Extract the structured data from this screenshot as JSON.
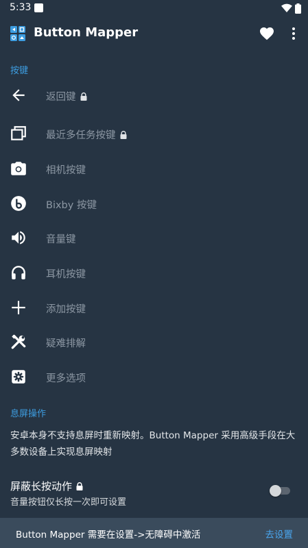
{
  "status_bar": {
    "time": "5:33"
  },
  "app_bar": {
    "title": "Button Mapper"
  },
  "sections": {
    "buttons_header": "按键",
    "screen_off_header": "息屏操作"
  },
  "items": [
    {
      "label": "返回键",
      "icon": "arrow-left-icon",
      "locked": true
    },
    {
      "label": "最近多任务按键",
      "icon": "recents-icon",
      "locked": true
    },
    {
      "label": "相机按键",
      "icon": "camera-icon",
      "locked": false
    },
    {
      "label": "Bixby 按键",
      "icon": "bixby-icon",
      "locked": false
    },
    {
      "label": "音量键",
      "icon": "volume-icon",
      "locked": false
    },
    {
      "label": "耳机按键",
      "icon": "headphones-icon",
      "locked": false
    },
    {
      "label": "添加按键",
      "icon": "plus-icon",
      "locked": false
    },
    {
      "label": "疑难排解",
      "icon": "tools-icon",
      "locked": false
    },
    {
      "label": "更多选项",
      "icon": "settings-icon",
      "locked": false
    }
  ],
  "screen_off": {
    "description": "安卓本身不支持息屏时重新映射。Button Mapper 采用高级手段在大多数设备上实现息屏映射",
    "switch_title": "屏蔽长按动作",
    "switch_subtitle": "音量按钮仅长按一次即可设置",
    "switch_on": false
  },
  "snackbar": {
    "message": "Button Mapper 需要在设置->无障碍中激活",
    "action": "去设置"
  },
  "colors": {
    "background": "#263443",
    "accent": "#3d9de0",
    "snackbar": "#3a4b5c"
  }
}
